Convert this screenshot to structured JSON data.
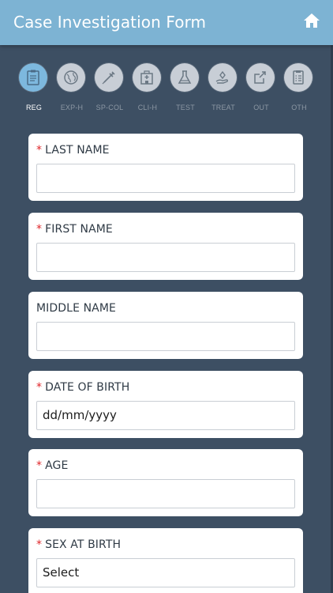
{
  "header": {
    "title": "Case Investigation Form",
    "home_icon": "home-icon"
  },
  "steps": [
    {
      "label": "REG",
      "icon": "clipboard-icon",
      "active": true
    },
    {
      "label": "EXP-H",
      "icon": "globe-icon",
      "active": false
    },
    {
      "label": "SP-COL",
      "icon": "syringe-icon",
      "active": false
    },
    {
      "label": "CLI-H",
      "icon": "hospital-icon",
      "active": false
    },
    {
      "label": "TEST",
      "icon": "flask-icon",
      "active": false
    },
    {
      "label": "TREAT",
      "icon": "hand-care-icon",
      "active": false
    },
    {
      "label": "OUT",
      "icon": "share-icon",
      "active": false
    },
    {
      "label": "OTH",
      "icon": "list-icon",
      "active": false
    }
  ],
  "form": {
    "last_name": {
      "label": "LAST NAME",
      "required": "*",
      "value": ""
    },
    "first_name": {
      "label": "FIRST NAME",
      "required": "*",
      "value": ""
    },
    "middle_name": {
      "label": "MIDDLE NAME",
      "value": ""
    },
    "dob": {
      "label": "DATE OF BIRTH",
      "required": "*",
      "value": "dd/mm/yyyy"
    },
    "age": {
      "label": "AGE",
      "required": "*",
      "value": ""
    },
    "sex": {
      "label": "SEX AT BIRTH",
      "required": "*",
      "value": "Select"
    }
  },
  "colors": {
    "header": "#7db3d3",
    "background": "#3d4f63",
    "active_step": "#7db8de",
    "required": "#e0262a"
  }
}
